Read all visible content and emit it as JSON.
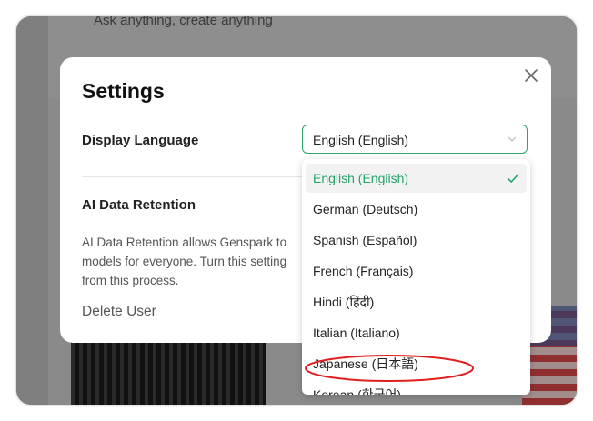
{
  "background": {
    "prompt_placeholder": "Ask anything, create anything"
  },
  "settings": {
    "title": "Settings",
    "display_language_label": "Display Language",
    "selected_language": "English (English)",
    "ai_retention_label": "AI Data Retention",
    "ai_retention_desc": "AI Data Retention allows Genspark to models for everyone. Turn this setting from this process.",
    "delete_user": "Delete User"
  },
  "language_options": [
    {
      "label": "English (English)",
      "selected": true
    },
    {
      "label": "German (Deutsch)"
    },
    {
      "label": "Spanish (Español)"
    },
    {
      "label": "French (Français)"
    },
    {
      "label": "Hindi (हिंदी)"
    },
    {
      "label": "Italian (Italiano)"
    },
    {
      "label": "Japanese (日本語)",
      "highlighted": true
    },
    {
      "label": "Korean (한국어)"
    }
  ],
  "colors": {
    "accent": "#23a36a",
    "annotation": "#e02020"
  },
  "icons": {
    "close": "close-icon",
    "chevron": "chevron-down-icon",
    "check": "checkmark-icon"
  }
}
